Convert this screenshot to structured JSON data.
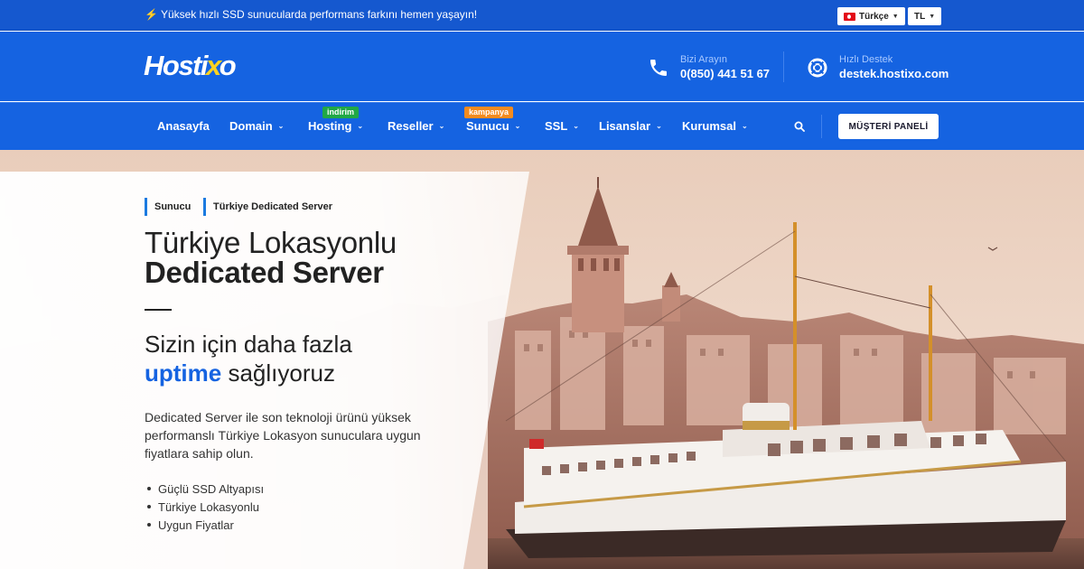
{
  "topbar": {
    "notice": "Yüksek hızlı SSD sunucularda performans farkını hemen yaşayın!",
    "language": "Türkçe",
    "currency": "TL"
  },
  "header": {
    "logo_left": "Hosti",
    "logo_x": "x",
    "logo_right": "o",
    "phone_label": "Bizi Arayın",
    "phone_value": "0(850) 441 51 67",
    "support_label": "Hızlı Destek",
    "support_value": "destek.hostixo.com"
  },
  "nav": {
    "items": [
      {
        "label": "Anasayfa",
        "chevron": false
      },
      {
        "label": "Domain",
        "chevron": true
      },
      {
        "label": "Hosting",
        "chevron": true,
        "badge": "indirim"
      },
      {
        "label": "Reseller",
        "chevron": true
      },
      {
        "label": "Sunucu",
        "chevron": true,
        "badge": "kampanya"
      },
      {
        "label": "SSL",
        "chevron": true
      },
      {
        "label": "Lisanslar",
        "chevron": true
      },
      {
        "label": "Kurumsal",
        "chevron": true
      }
    ],
    "panel_button": "MÜŞTERİ PANELİ"
  },
  "hero": {
    "breadcrumb": [
      "Sunucu",
      "Türkiye Dedicated Server"
    ],
    "title_light": "Türkiye Lokasyonlu",
    "title_bold": "Dedicated Server",
    "subtitle_line1": "Sizin için daha fazla",
    "subtitle_highlight": "uptime",
    "subtitle_rest": "sağlıyoruz",
    "description": "Dedicated Server ile son teknoloji ürünü yüksek performanslı Türkiye Lokasyon sunuculara uygun fiyatlara sahip olun.",
    "features": [
      "Güçlü SSD Altyapısı",
      "Türkiye Lokasyonlu",
      "Uygun Fiyatlar"
    ]
  },
  "colors": {
    "primary": "#1563e1",
    "topbar": "#1558cf",
    "accent_yellow": "#ffd21f",
    "badge_green": "#21a846",
    "badge_orange": "#f48b1f"
  }
}
